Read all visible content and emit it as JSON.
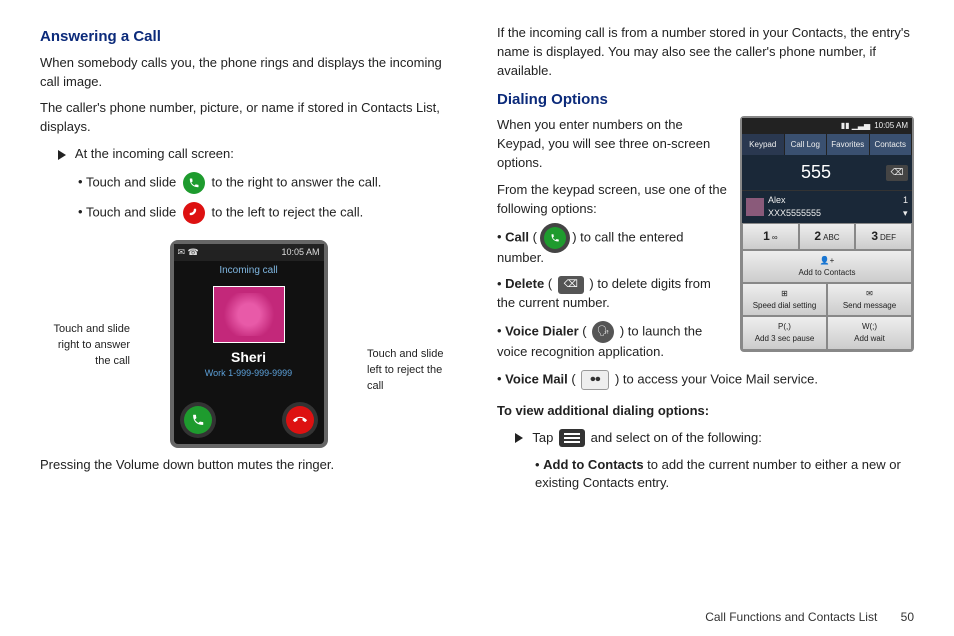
{
  "left": {
    "h_answering": "Answering a Call",
    "p1": "When somebody calls you, the phone rings and displays the incoming call image.",
    "p2": "The caller's phone number, picture, or name if stored in Contacts List, displays.",
    "at_screen": "At the incoming call screen:",
    "slide_right_pre": "Touch and slide ",
    "slide_right_post": " to the right to answer the call.",
    "slide_left_pre": "Touch and slide ",
    "slide_left_post": " to the left to reject the call.",
    "callout_left": "Touch and slide right to answer the call",
    "callout_right": "Touch and slide left to reject the call",
    "p_mute": "Pressing the Volume down button mutes the ringer.",
    "phone": {
      "time": "10:05 AM",
      "incoming": "Incoming call",
      "name": "Sheri",
      "number": "Work 1-999-999-9999"
    }
  },
  "right": {
    "p_top": "If the incoming call is from a number stored in your Contacts, the entry's name is displayed. You may also see the caller's phone number, if available.",
    "h_dialing": "Dialing Options",
    "p_enter": "When you enter numbers on the Keypad, you will see three on-screen options.",
    "p_from": "From the keypad screen, use one of the following options:",
    "opt_call_b": "Call",
    "opt_call_t": " to call the entered number.",
    "opt_del_b": "Delete",
    "opt_del_t": " to delete digits from the current number.",
    "opt_vd_b": "Voice Dialer",
    "opt_vd_t": " to launch the voice recognition application.",
    "opt_vm_b": "Voice Mail",
    "opt_vm_t": " to access your Voice Mail service.",
    "h_additional": "To view additional dialing options:",
    "tap_pre": "Tap ",
    "tap_post": " and select on of the following:",
    "add_b": "Add to Contacts",
    "add_t": " to add the current number to either a new or existing Contacts entry.",
    "phone": {
      "time": "10:05 AM",
      "tabs": [
        "Keypad",
        "Call Log",
        "Favorites",
        "Contacts"
      ],
      "number": "555",
      "contact_name": "Alex",
      "contact_num": "XXX5555555",
      "keys": [
        {
          "n": "1",
          "l": "∞"
        },
        {
          "n": "2",
          "l": "ABC"
        },
        {
          "n": "3",
          "l": "DEF"
        }
      ],
      "act_addcontacts": "Add to Contacts",
      "act_speed": "Speed dial setting",
      "act_send": "Send message",
      "act_pause_k": "P(,)",
      "act_pause_l": "Add 3 sec pause",
      "act_wait_k": "W(;)",
      "act_wait_l": "Add wait"
    }
  },
  "footer": {
    "section": "Call Functions and Contacts List",
    "page": "50"
  }
}
